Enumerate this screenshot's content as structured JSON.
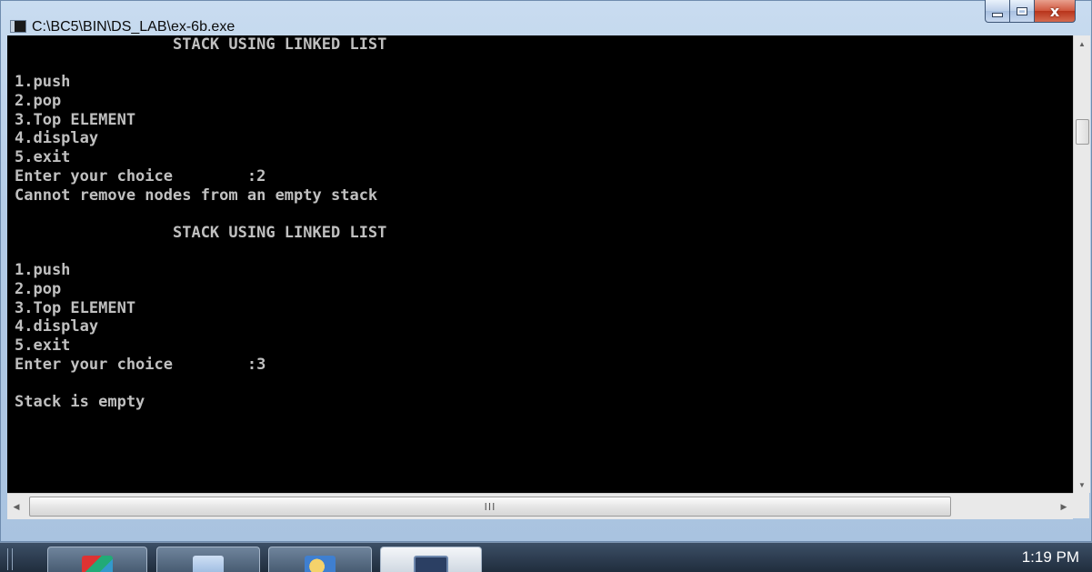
{
  "window": {
    "title": "C:\\BC5\\BIN\\DS_LAB\\ex-6b.exe",
    "controls": {
      "minimize": "–",
      "maximize": "□",
      "close": "x"
    }
  },
  "console": {
    "lines": [
      "                 STACK USING LINKED LIST",
      "",
      "1.push",
      "2.pop",
      "3.Top ELEMENT",
      "4.display",
      "5.exit",
      "Enter your choice        :2",
      "Cannot remove nodes from an empty stack",
      "",
      "                 STACK USING LINKED LIST",
      "",
      "1.push",
      "2.pop",
      "3.Top ELEMENT",
      "4.display",
      "5.exit",
      "Enter your choice        :3",
      "",
      "Stack is empty"
    ]
  },
  "scrollbar": {
    "vertical": {
      "up": "▲",
      "down": "▼"
    },
    "horizontal": {
      "left": "◀",
      "right": "▶",
      "grip": "III"
    }
  },
  "taskbar": {
    "clock": "1:19 PM",
    "buttons": [
      "app-1",
      "app-2",
      "app-3",
      "console-window"
    ]
  },
  "colors": {
    "console_bg": "#000000",
    "console_text": "#c0c0c0",
    "close_button": "#c9452b"
  }
}
